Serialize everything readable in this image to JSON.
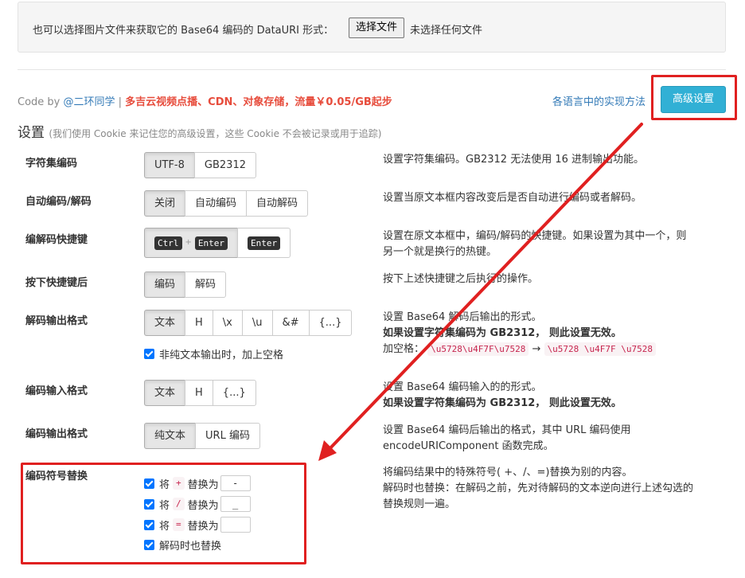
{
  "file_panel": {
    "text": "也可以选择图片文件来获取它的 Base64 编码的 DataURI 形式：",
    "button": "选择文件",
    "status": "未选择任何文件"
  },
  "credit": {
    "prefix": "Code by ",
    "author": "@二环同学",
    "separator": " | ",
    "promo": "多吉云视频点播、CDN、对象存储，流量￥0.05/GB起步"
  },
  "impl_link": "各语言中的实现方法",
  "advanced_button": "高级设置",
  "settings": {
    "title": "设置",
    "note": "(我们使用 Cookie 来记住您的高级设置，这些 Cookie 不会被记录或用于追踪)"
  },
  "rows": {
    "charset": {
      "label": "字符集编码",
      "options": [
        "UTF-8",
        "GB2312"
      ],
      "desc": "设置字符集编码。GB2312 无法使用 16 进制输出功能。"
    },
    "auto": {
      "label": "自动编码/解码",
      "options": [
        "关闭",
        "自动编码",
        "自动解码"
      ],
      "desc": "设置当原文本框内容改变后是否自动进行编码或者解码。"
    },
    "hotkey": {
      "label": "编解码快捷键",
      "key_ctrl": "Ctrl",
      "key_plus": "+",
      "key_enter": "Enter",
      "desc1": "设置在原文本框中，编码/解码的快捷键。如果设置为其中一个，则",
      "desc2": "另一个就是换行的热键。"
    },
    "after": {
      "label": "按下快捷键后",
      "options": [
        "编码",
        "解码"
      ],
      "desc": "按下上述快捷键之后执行的操作。"
    },
    "decode_out": {
      "label": "解码输出格式",
      "options": [
        "文本",
        "H",
        "\\x",
        "\\u",
        "&#",
        "{...}"
      ],
      "checkbox": "非纯文本输出时，加上空格",
      "desc1": "设置 Base64 解码后输出的形式。",
      "desc2": "如果设置字符集编码为 GB2312， 则此设置无效。",
      "desc3_prefix": "加空格：",
      "example_before": "\\u5728\\u4F7F\\u7528",
      "arrow": "→",
      "example_after": "\\u5728 \\u4F7F \\u7528"
    },
    "encode_in": {
      "label": "编码输入格式",
      "options": [
        "文本",
        "H",
        "{...}"
      ],
      "desc1": "设置 Base64 编码输入的的形式。",
      "desc2": "如果设置字符集编码为 GB2312， 则此设置无效。"
    },
    "encode_out": {
      "label": "编码输出格式",
      "options": [
        "纯文本",
        "URL 编码"
      ],
      "desc1": "设置 Base64 编码后输出的格式，其中 URL 编码使用",
      "desc2": "encodeURIComponent 函数完成。"
    },
    "replace": {
      "label": "编码符号替换",
      "word_jiang": "将",
      "word_to": "替换为",
      "items": [
        {
          "from": "+",
          "to": "-"
        },
        {
          "from": "/",
          "to": "_"
        },
        {
          "from": "=",
          "to": ""
        }
      ],
      "decode_too": "解码时也替换",
      "desc1": "将编码结果中的特殊符号( +、/、=)替换为别的内容。",
      "desc2": "解码时也替换：在解码之前，先对待解码的文本逆向进行上述勾选的",
      "desc3": "替换规则一遍。"
    }
  },
  "annotation": {
    "color": "#e02020"
  }
}
